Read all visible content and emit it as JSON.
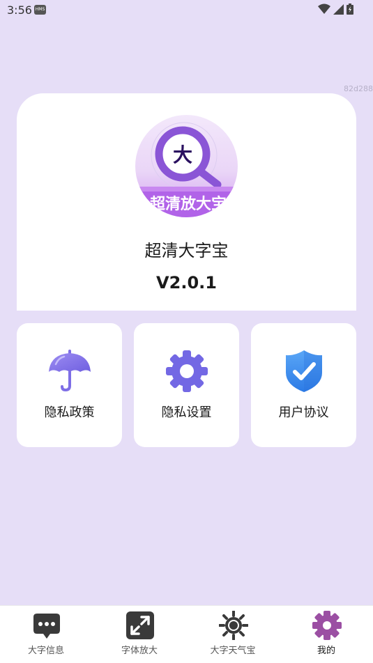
{
  "status_bar": {
    "time": "3:56",
    "badge": "HMS"
  },
  "watermark": "82d288",
  "app": {
    "logo_glyph": "大",
    "logo_banner": "超清放大宝",
    "name": "超清大字宝",
    "version": "V2.0.1"
  },
  "features": [
    {
      "label": "隐私政策",
      "icon": "umbrella-icon"
    },
    {
      "label": "隐私设置",
      "icon": "gear-icon"
    },
    {
      "label": "用户协议",
      "icon": "shield-check-icon"
    }
  ],
  "bottom_nav": {
    "items": [
      {
        "label": "大字信息",
        "icon": "message-icon"
      },
      {
        "label": "字体放大",
        "icon": "expand-icon"
      },
      {
        "label": "大字天气宝",
        "icon": "sun-icon"
      },
      {
        "label": "我的",
        "icon": "gear-icon",
        "active": true
      }
    ]
  },
  "colors": {
    "background": "#e6def7",
    "accent_purple": "#7e6ee6",
    "active_tab": "#9b4fa3",
    "shield_blue": "#3d8ff0"
  }
}
